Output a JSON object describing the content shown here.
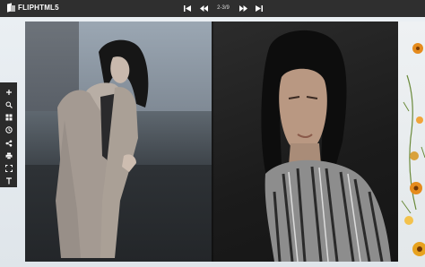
{
  "brand": {
    "name": "FLIPHTML5"
  },
  "pager": {
    "first_label": "⏮",
    "prev_label": "◀◀",
    "page_indicator": "2-3/9",
    "next_label": "▶▶",
    "last_label": "⏭"
  },
  "toolbar": {
    "items": [
      {
        "icon": "plus-icon"
      },
      {
        "icon": "search-icon"
      },
      {
        "icon": "grid-icon"
      },
      {
        "icon": "clock-icon"
      },
      {
        "icon": "share-icon"
      },
      {
        "icon": "print-icon"
      },
      {
        "icon": "fullscreen-icon"
      },
      {
        "icon": "text-icon"
      }
    ]
  },
  "colors": {
    "topbar": "#2f2f2f",
    "toolbar": "#2b2b2b",
    "background": "#e9eef2",
    "flower_orange": "#e58b1d"
  }
}
